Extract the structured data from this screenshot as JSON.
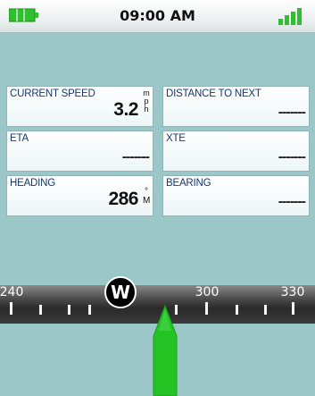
{
  "status_bar": {
    "time": "09:00 AM",
    "battery_icon": "battery-icon",
    "signal_icon": "signal-strength-icon",
    "battery_color": "#2fbf2f",
    "signal_color": "#2fbf2f"
  },
  "fields": {
    "current_speed": {
      "label": "CURRENT SPEED",
      "value": "3.2",
      "unit": [
        "m",
        "p",
        "h"
      ]
    },
    "distance_to_next": {
      "label": "DISTANCE TO NEXT",
      "value": "-------"
    },
    "eta": {
      "label": "ETA",
      "value": "-------"
    },
    "xte": {
      "label": "XTE",
      "value": "-------"
    },
    "heading": {
      "label": "HEADING",
      "value": "286",
      "unit": [
        "°",
        "M"
      ]
    },
    "bearing": {
      "label": "BEARING",
      "value": "-------"
    }
  },
  "compass": {
    "labels": [
      "240",
      "300",
      "330"
    ],
    "cardinal": "W",
    "pointer_color": "#22c322"
  }
}
